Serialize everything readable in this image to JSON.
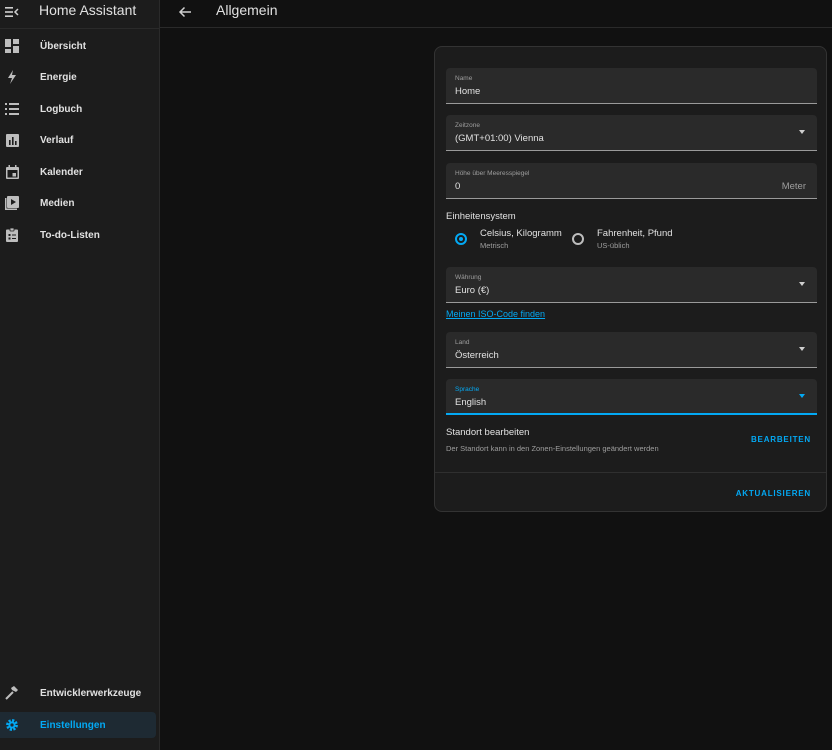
{
  "app": {
    "title": "Home Assistant"
  },
  "header": {
    "title": "Allgemein"
  },
  "sidebar": {
    "items": [
      {
        "label": "Übersicht",
        "icon": "dashboard-icon"
      },
      {
        "label": "Energie",
        "icon": "lightning-icon"
      },
      {
        "label": "Logbuch",
        "icon": "list-icon"
      },
      {
        "label": "Verlauf",
        "icon": "chart-icon"
      },
      {
        "label": "Kalender",
        "icon": "calendar-icon"
      },
      {
        "label": "Medien",
        "icon": "media-icon"
      },
      {
        "label": "To-do-Listen",
        "icon": "clipboard-icon"
      }
    ],
    "bottom_items": [
      {
        "label": "Entwicklerwerkzeuge",
        "icon": "hammer-icon"
      },
      {
        "label": "Einstellungen",
        "icon": "gear-icon",
        "active": true
      }
    ]
  },
  "form": {
    "name": {
      "label": "Name",
      "value": "Home"
    },
    "timezone": {
      "label": "Zeitzone",
      "value": "(GMT+01:00) Vienna"
    },
    "elevation": {
      "label": "Höhe über Meeresspiegel",
      "value": "0",
      "suffix": "Meter"
    },
    "unit_system": {
      "label": "Einheitensystem",
      "options": [
        {
          "label": "Celsius, Kilogramm",
          "sub": "Metrisch",
          "checked": true
        },
        {
          "label": "Fahrenheit, Pfund",
          "sub": "US-üblich",
          "checked": false
        }
      ]
    },
    "currency": {
      "label": "Währung",
      "value": "Euro (€)"
    },
    "iso_link": "Meinen ISO-Code finden",
    "country": {
      "label": "Land",
      "value": "Österreich"
    },
    "language": {
      "label": "Sprache",
      "value": "English"
    },
    "location": {
      "title": "Standort bearbeiten",
      "description": "Der Standort kann in den Zonen-Einstellungen geändert werden",
      "button": "BEARBEITEN"
    },
    "update_button": "AKTUALISIEREN"
  },
  "colors": {
    "accent": "#03a9f4",
    "background": "#111111",
    "surface": "#1c1c1c",
    "field": "#2a2a2a"
  }
}
